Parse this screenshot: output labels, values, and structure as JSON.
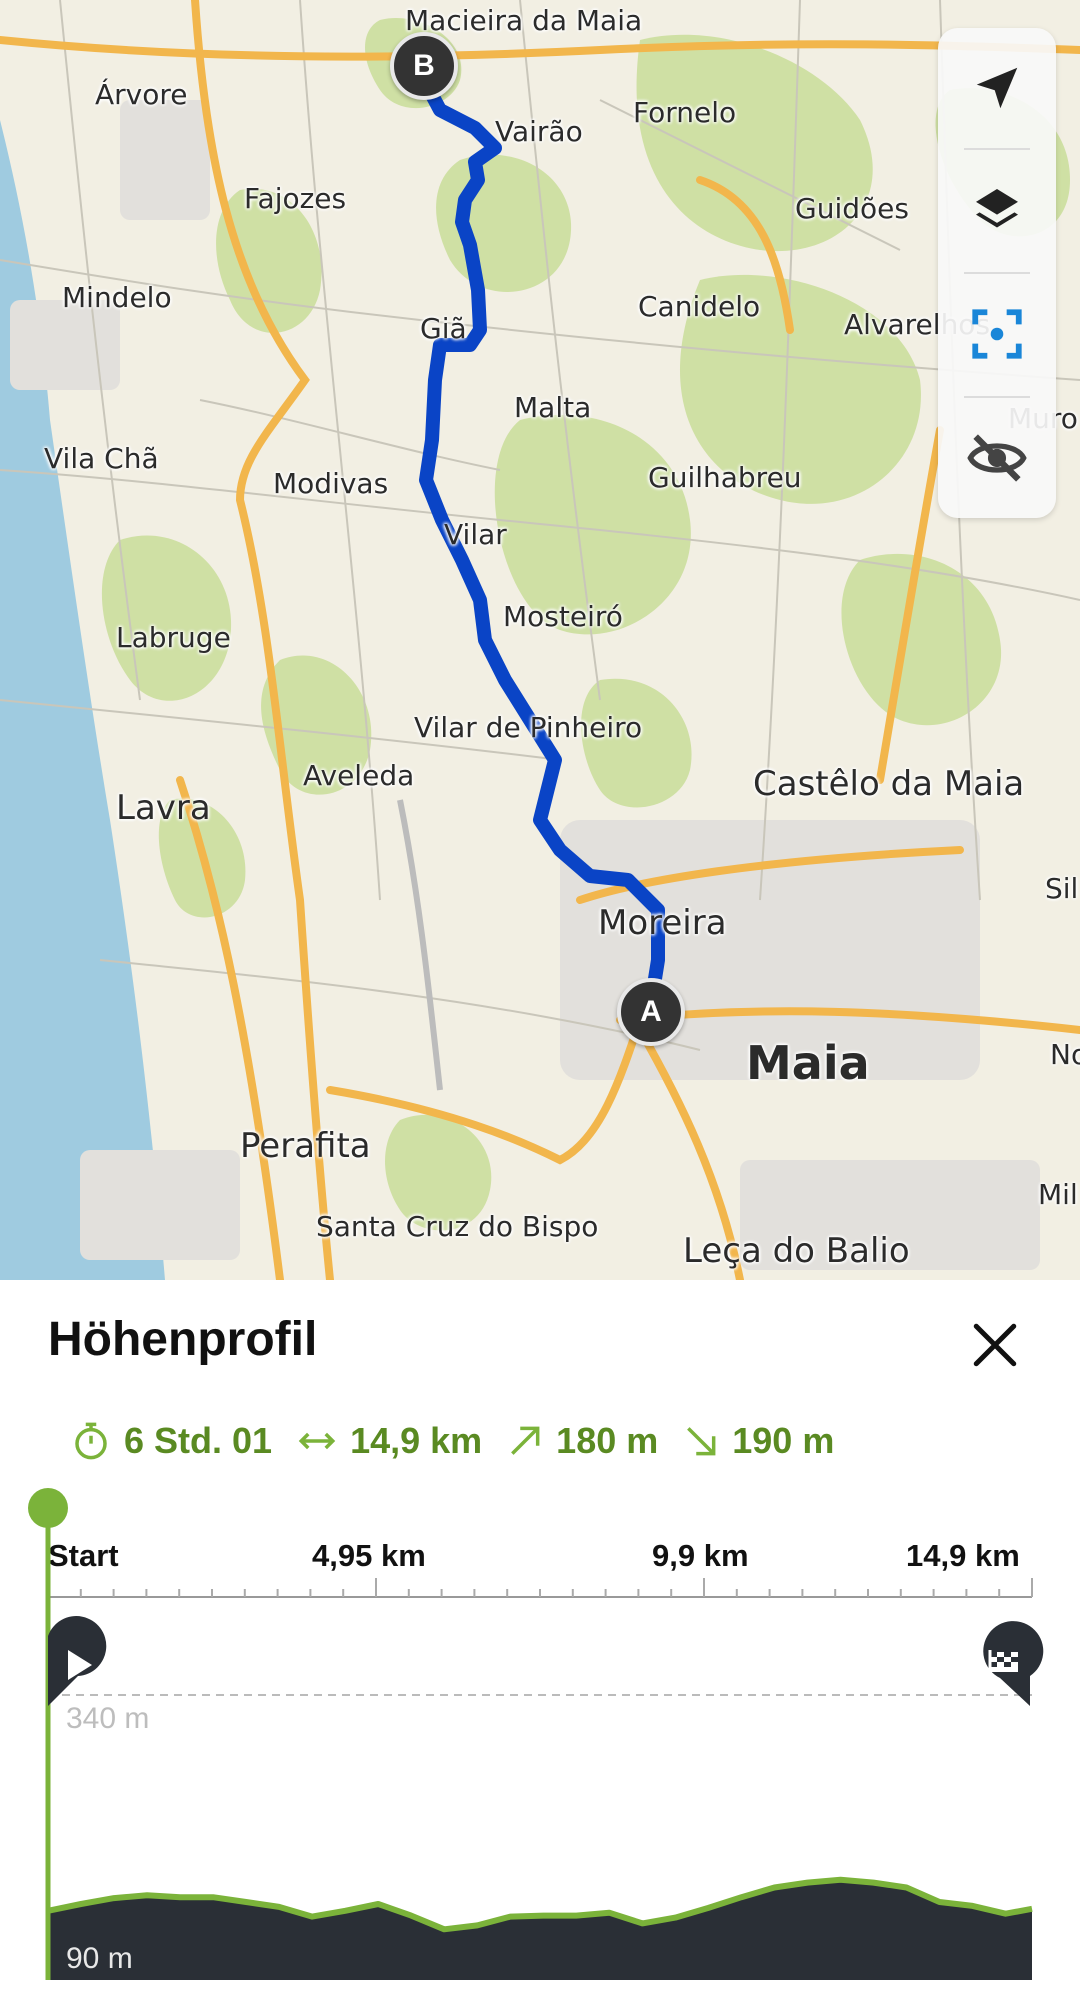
{
  "map": {
    "places": [
      {
        "id": "macieira-da-maia",
        "name": "Macieira da Maia"
      },
      {
        "id": "arvore",
        "name": "Árvore"
      },
      {
        "id": "vairao",
        "name": "Vairão"
      },
      {
        "id": "fornelo",
        "name": "Fornelo"
      },
      {
        "id": "fajozes",
        "name": "Fajozes"
      },
      {
        "id": "guidoes",
        "name": "Guidões"
      },
      {
        "id": "mindelo",
        "name": "Mindelo"
      },
      {
        "id": "gia",
        "name": "Giã"
      },
      {
        "id": "canidelo",
        "name": "Canidelo"
      },
      {
        "id": "alvarelhos",
        "name": "Alvarelhos"
      },
      {
        "id": "malta",
        "name": "Malta"
      },
      {
        "id": "muro",
        "name": "Muro"
      },
      {
        "id": "vila-cha",
        "name": "Vila Chã"
      },
      {
        "id": "modivas",
        "name": "Modivas"
      },
      {
        "id": "guilhabreu",
        "name": "Guilhabreu"
      },
      {
        "id": "vilar",
        "name": "Vilar"
      },
      {
        "id": "mosteiro",
        "name": "Mosteiró"
      },
      {
        "id": "labruge",
        "name": "Labruge"
      },
      {
        "id": "vilar-de-pinheiro",
        "name": "Vilar de Pinheiro"
      },
      {
        "id": "aveleda",
        "name": "Aveleda"
      },
      {
        "id": "castelo-da-maia",
        "name": "Castêlo da Maia"
      },
      {
        "id": "lavra",
        "name": "Lavra"
      },
      {
        "id": "silva",
        "name": "Sil"
      },
      {
        "id": "moreira",
        "name": "Moreira"
      },
      {
        "id": "maia",
        "name": "Maia"
      },
      {
        "id": "nogueira",
        "name": "No"
      },
      {
        "id": "perafita",
        "name": "Perafita"
      },
      {
        "id": "milheiros",
        "name": "Mil"
      },
      {
        "id": "santa-cruz-do-bispo",
        "name": "Santa Cruz do Bispo"
      },
      {
        "id": "leca-do-balio",
        "name": "Leça do Balio"
      }
    ],
    "start_marker": "A",
    "end_marker": "B",
    "colors": {
      "route": "#0a44c6",
      "water": "#9fcbe0",
      "land": "#f2efe3",
      "forest": "#cfe0a4",
      "road": "#f2b64c"
    }
  },
  "controls": [
    {
      "id": "locate",
      "icon": "navigation-arrow-icon"
    },
    {
      "id": "layers",
      "icon": "layers-icon"
    },
    {
      "id": "focus",
      "icon": "focus-target-icon"
    },
    {
      "id": "hide",
      "icon": "eye-off-icon"
    }
  ],
  "sheet": {
    "title": "Höhenprofil",
    "close_icon": "close-icon",
    "stats": {
      "duration": "6 Std. 01",
      "distance": "14,9 km",
      "ascent": "180 m",
      "descent": "190 m"
    },
    "axis_labels": [
      "Start",
      "4,95 km",
      "9,9 km",
      "14,9 km"
    ],
    "elevation_max_label": "340 m",
    "elevation_min_label": "90 m",
    "accent_color": "#7bb33a"
  },
  "chart_data": {
    "type": "area",
    "xlabel": "",
    "ylabel": "",
    "xlim": [
      0,
      14.9
    ],
    "ylim": [
      90,
      340
    ],
    "x": [
      0,
      0.5,
      1,
      1.5,
      2,
      2.5,
      3,
      3.5,
      4,
      4.5,
      5,
      5.5,
      6,
      6.5,
      7,
      7.5,
      8,
      8.5,
      9,
      9.5,
      10,
      10.5,
      11,
      11.5,
      12,
      12.5,
      13,
      13.5,
      14,
      14.5,
      14.9
    ],
    "series": [
      {
        "values": [
          118,
          125,
          131,
          134,
          132,
          132,
          127,
          122,
          112,
          118,
          125,
          113,
          99,
          103,
          112,
          113,
          113,
          116,
          105,
          111,
          121,
          132,
          142,
          147,
          150,
          147,
          142,
          127,
          123,
          115,
          120
        ]
      }
    ]
  }
}
